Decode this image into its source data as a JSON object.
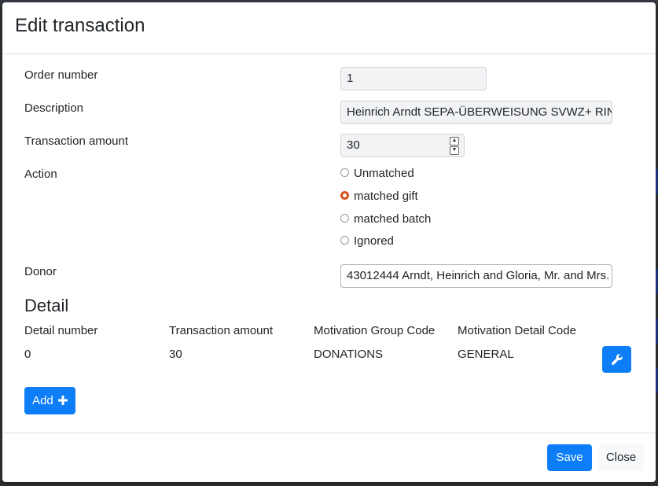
{
  "modal": {
    "title": "Edit transaction",
    "fields": {
      "order_number_label": "Order number",
      "order_number_value": "1",
      "description_label": "Description",
      "description_value": "Heinrich Arndt SEPA-ÜBERWEISUNG SVWZ+ RIN",
      "amount_label": "Transaction amount",
      "amount_value": "30",
      "action_label": "Action",
      "donor_label": "Donor",
      "donor_value": "43012444 Arndt, Heinrich and Gloria, Mr. and Mrs."
    },
    "actions": {
      "options": [
        "Unmatched",
        "matched gift",
        "matched batch",
        "Ignored"
      ],
      "selected": "matched gift"
    },
    "detail": {
      "title": "Detail",
      "columns": [
        "Detail number",
        "Transaction amount",
        "Motivation Group Code",
        "Motivation Detail Code"
      ],
      "rows": [
        [
          "0",
          "30",
          "DONATIONS",
          "GENERAL"
        ]
      ],
      "add_label": "Add",
      "edit_icon": "wrench-icon",
      "add_icon": "plus-icon"
    },
    "footer": {
      "save_label": "Save",
      "close_label": "Close"
    }
  },
  "colors": {
    "primary": "#0d7ef8",
    "radio_selected": "#d9531e",
    "backdrop": "#2f3133"
  }
}
